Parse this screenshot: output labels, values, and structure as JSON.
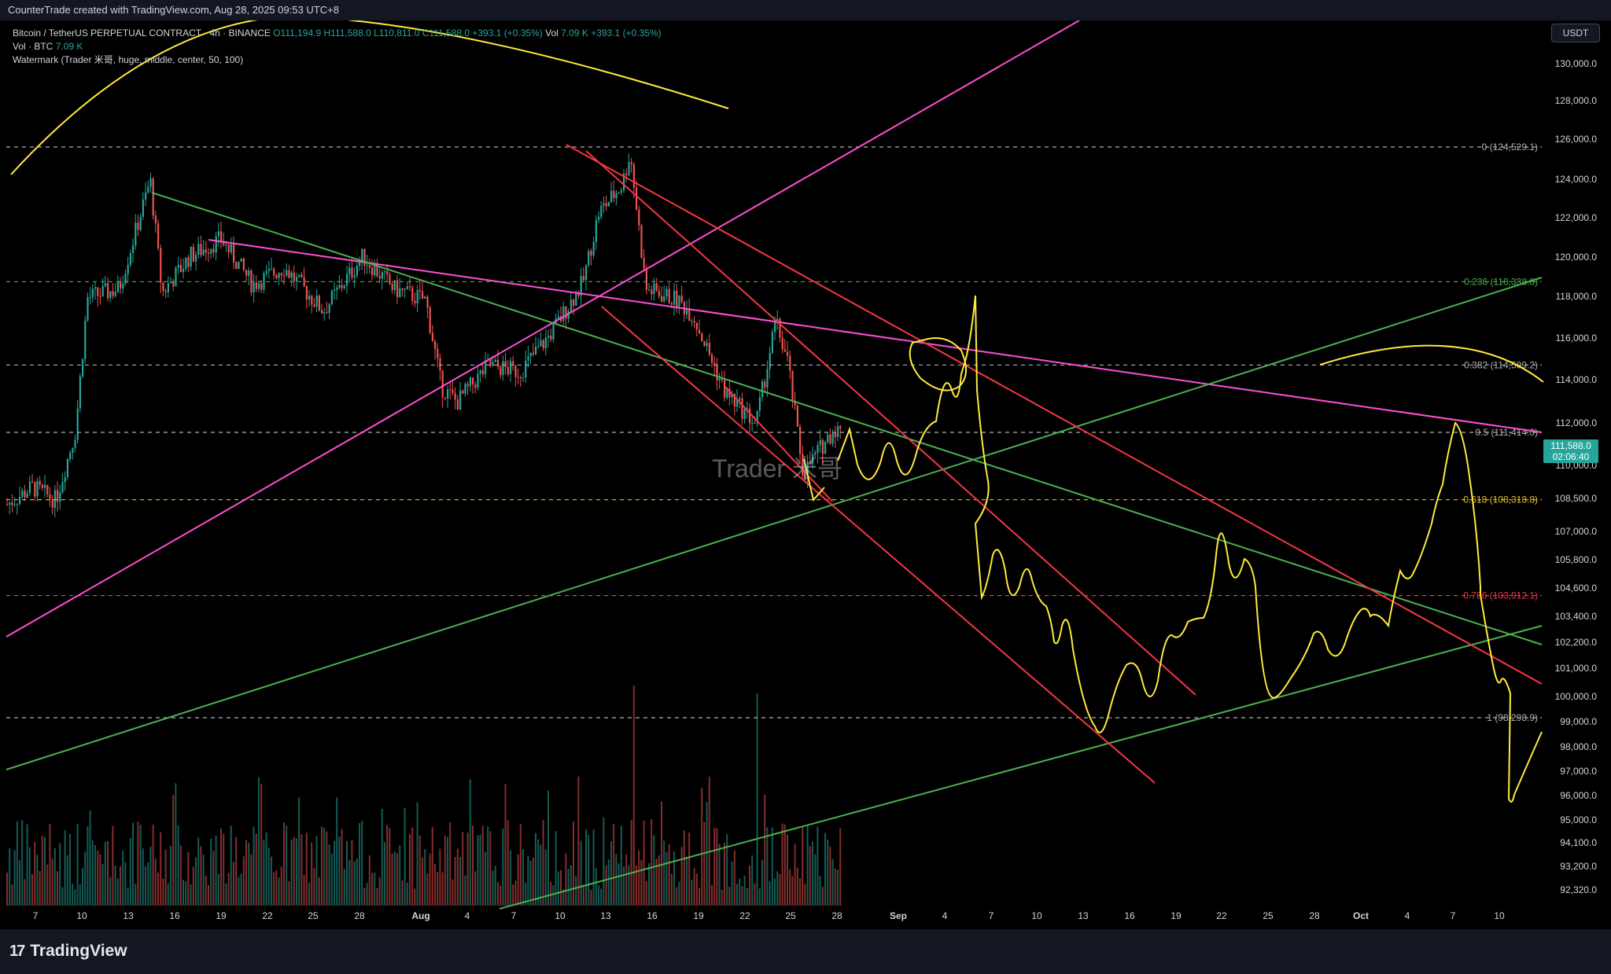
{
  "header": {
    "attribution": "CounterTrade created with TradingView.com, Aug 28, 2025 09:53 UTC+8"
  },
  "legend": {
    "symbol": "Bitcoin / TetherUS PERPETUAL CONTRACT · 4h · BINANCE",
    "open": "O111,194.9",
    "high": "H111,588.0",
    "low": "L110,811.0",
    "close": "C111,588.0",
    "change": "+393.1 (+0.35%)",
    "vol_label": "Vol",
    "vol_value": "7.09 K",
    "change2": "+393.1 (+0.35%)",
    "vol_line_label": "Vol · BTC",
    "vol_line_value": "7.09 K",
    "watermark_line": "Watermark (Trader 米哥, huge, middle, center, 50, 100)"
  },
  "currency_button": "USDT",
  "watermark": "Trader 米哥",
  "price_tag": {
    "price": "111,588.0",
    "countdown": "02:06:40"
  },
  "footer": {
    "brand": "TradingView",
    "brand_mark": "17"
  },
  "colors": {
    "up": "#26a69a",
    "down": "#ef5350",
    "magenta": "#ff4fd2",
    "green_line": "#4caf50",
    "red_line": "#f23645",
    "yellow": "#ffeb3b",
    "fib_gray": "#9e9e9e",
    "fib_green": "#4caf50",
    "fib_yellow": "#e6c229",
    "fib_red": "#f23645"
  },
  "chart_data": {
    "type": "candlestick",
    "timeframe": "4h",
    "y_axis_ticks": [
      "130,000.0",
      "128,000.0",
      "126,000.0",
      "124,000.0",
      "122,000.0",
      "120,000.0",
      "118,000.0",
      "116,000.0",
      "114,000.0",
      "112,000.0",
      "110,000.0",
      "108,500.0",
      "107,000.0",
      "105,800.0",
      "104,600.0",
      "103,400.0",
      "102,200.0",
      "101,000.0",
      "100,000.0",
      "99,000.0",
      "98,000.0",
      "97,000.0",
      "96,000.0",
      "95,000.0",
      "94,100.0",
      "93,200.0",
      "92,320.0"
    ],
    "x_axis_ticks": [
      "7",
      "10",
      "13",
      "16",
      "19",
      "22",
      "25",
      "28",
      "Aug",
      "4",
      "7",
      "10",
      "13",
      "16",
      "19",
      "22",
      "25",
      "28",
      "Sep",
      "4",
      "7",
      "10",
      "13",
      "16",
      "19",
      "22",
      "25",
      "28",
      "Oct",
      "4",
      "7",
      "10"
    ],
    "fib_levels": [
      {
        "label": "0 (124,529.1)",
        "price": 124529.1,
        "style": "gray"
      },
      {
        "label": "0.236 (118,338.8)",
        "price": 118338.8,
        "style": "green"
      },
      {
        "label": "0.382 (114,509.2)",
        "price": 114509.2,
        "style": "gray"
      },
      {
        "label": "0.5 (111,414.0)",
        "price": 111414.0,
        "style": "gray"
      },
      {
        "label": "0.618 (108,318.8)",
        "price": 108318.8,
        "style": "yellow"
      },
      {
        "label": "0.786 (103,912.1)",
        "price": 103912.1,
        "style": "red"
      },
      {
        "label": "1 (98,298.9)",
        "price": 98298.9,
        "style": "gray"
      }
    ],
    "last_price": 111588.0
  }
}
